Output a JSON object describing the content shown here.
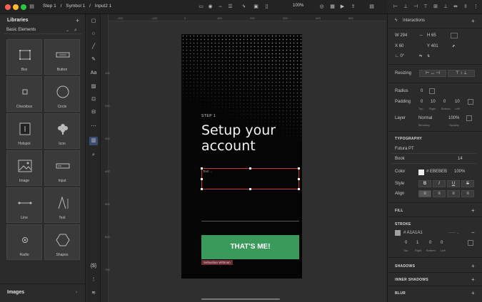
{
  "titlebar": {
    "breadcrumb": [
      "Step 1",
      "/",
      "Symbol 1",
      "/",
      "Input2 1"
    ],
    "zoom": "100%"
  },
  "libraries": {
    "title": "Libraries",
    "selected": "Basic Elements",
    "tiles": [
      "Box",
      "Button",
      "Checkbox",
      "Circle",
      "Hotspot",
      "Icon",
      "Image",
      "Input",
      "Line",
      "Text",
      "Radio",
      "Shapes"
    ],
    "footer": "Images"
  },
  "rulers": {
    "h": [
      "-200",
      "-100",
      "0",
      "100",
      "200",
      "300",
      "400",
      "500"
    ],
    "v": [
      "100",
      "200",
      "300",
      "400",
      "500",
      "600",
      "700"
    ]
  },
  "artboard": {
    "step": "STEP 1",
    "heading": "Setup your account",
    "input_placeholder": "Text ...",
    "cta": "THAT'S ME!",
    "author": "Sebastian Wittman"
  },
  "inspector": {
    "interactions": "Interactions",
    "w_label": "W",
    "w": "294",
    "h_label": "H",
    "h": "65",
    "x_label": "X",
    "x": "60",
    "y_label": "Y",
    "y": "401",
    "rot_label": "∟",
    "rot": "0°",
    "resizing": "Resizing",
    "radius_label": "Radius",
    "radius": "0",
    "padding_label": "Padding",
    "padding": [
      "0",
      "10",
      "0",
      "10"
    ],
    "padding_sub": [
      "Top",
      "Right",
      "Bottom",
      "Left"
    ],
    "layer_label": "Layer",
    "blend": "Normal",
    "opacity": "100%",
    "blend_sub": "Blending",
    "opacity_sub": "Opacity",
    "typography": "TYPOGRAPHY",
    "font": "Futura PT",
    "weight": "Book",
    "size": "14",
    "color_label": "Color",
    "color_hex": "# EBEBEB",
    "color_opacity": "100%",
    "style_label": "Style",
    "align_label": "Align",
    "style_btns": [
      "B",
      "I",
      "U",
      "S"
    ],
    "fill": "FILL",
    "stroke": "STROKE",
    "stroke_hex": "# A1A1A1",
    "stroke_widths": [
      "0",
      "1",
      "0",
      "0"
    ],
    "stroke_sub": [
      "Top",
      "Right",
      "Bottom",
      "Left"
    ],
    "shadows": "SHADOWS",
    "inner_shadows": "INNER SHADOWS",
    "blur": "BLUR"
  },
  "colors": {
    "cta": "#3a9a5c",
    "text_color": "#EBEBEB",
    "stroke_color": "#A1A1A1",
    "close": "#ff5f57",
    "minimize": "#febc2e",
    "zoom": "#28c840"
  }
}
